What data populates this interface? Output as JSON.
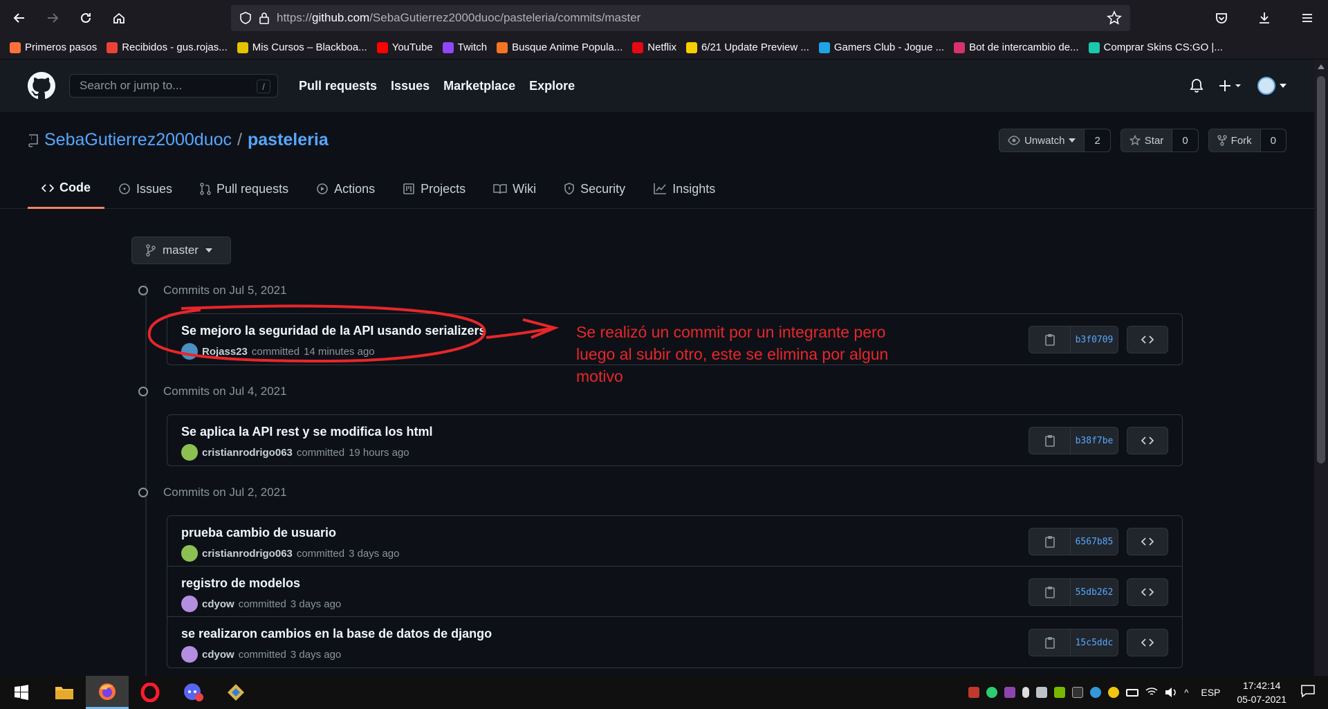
{
  "browser": {
    "url_prefix": "https://",
    "url_host": "github.com",
    "url_path": "/SebaGutierrez2000duoc/pasteleria/commits/master",
    "bookmarks": [
      {
        "label": "Primeros pasos",
        "color": "#ff7139"
      },
      {
        "label": "Recibidos - gus.rojas...",
        "color": "#ea4335"
      },
      {
        "label": "Mis Cursos – Blackboa...",
        "color": "#e6c300"
      },
      {
        "label": "YouTube",
        "color": "#ff0000"
      },
      {
        "label": "Twitch",
        "color": "#9146ff"
      },
      {
        "label": "Busque Anime Popula...",
        "color": "#f47521"
      },
      {
        "label": "Netflix",
        "color": "#e50914"
      },
      {
        "label": "6/21 Update Preview ...",
        "color": "#f6d000"
      },
      {
        "label": "Gamers Club - Jogue ...",
        "color": "#1ea3e6"
      },
      {
        "label": "Bot de intercambio de...",
        "color": "#d6336c"
      },
      {
        "label": "Comprar Skins CS:GO |...",
        "color": "#1bc8b0"
      }
    ]
  },
  "github": {
    "search_placeholder": "Search or jump to...",
    "search_key": "/",
    "nav": [
      "Pull requests",
      "Issues",
      "Marketplace",
      "Explore"
    ]
  },
  "repo": {
    "owner": "SebaGutierrez2000duoc",
    "separator": "/",
    "name": "pasteleria",
    "unwatch_label": "Unwatch",
    "unwatch_count": "2",
    "star_label": "Star",
    "star_count": "0",
    "fork_label": "Fork",
    "fork_count": "0",
    "tabs": [
      "Code",
      "Issues",
      "Pull requests",
      "Actions",
      "Projects",
      "Wiki",
      "Security",
      "Insights"
    ]
  },
  "branch": "master",
  "groups": [
    {
      "title": "Commits on Jul 5, 2021",
      "commits": [
        {
          "message": "Se mejoro la seguridad de la API usando serializers",
          "author": "Rojass23",
          "action": "committed",
          "time": "14 minutes ago",
          "sha": "b3f0709",
          "avatar_color": "#4a90c2"
        }
      ]
    },
    {
      "title": "Commits on Jul 4, 2021",
      "commits": [
        {
          "message": "Se aplica la API rest y se modifica los html",
          "author": "cristianrodrigo063",
          "action": "committed",
          "time": "19 hours ago",
          "sha": "b38f7be",
          "avatar_color": "#8cc152"
        }
      ]
    },
    {
      "title": "Commits on Jul 2, 2021",
      "commits": [
        {
          "message": "prueba cambio de usuario",
          "author": "cristianrodrigo063",
          "action": "committed",
          "time": "3 days ago",
          "sha": "6567b85",
          "avatar_color": "#8cc152"
        },
        {
          "message": "registro de modelos",
          "author": "cdyow",
          "action": "committed",
          "time": "3 days ago",
          "sha": "55db262",
          "avatar_color": "#b48ee0"
        },
        {
          "message": "se realizaron cambios en la base de datos de django",
          "author": "cdyow",
          "action": "committed",
          "time": "3 days ago",
          "sha": "15c5ddc",
          "avatar_color": "#b48ee0"
        }
      ]
    }
  ],
  "annotation": "Se realizó un commit por un integrante pero luego al subir otro, este se elimina por algun motivo",
  "annotation_color": "#e8262a",
  "taskbar": {
    "language": "ESP",
    "time": "17:42:14",
    "date": "05-07-2021"
  }
}
